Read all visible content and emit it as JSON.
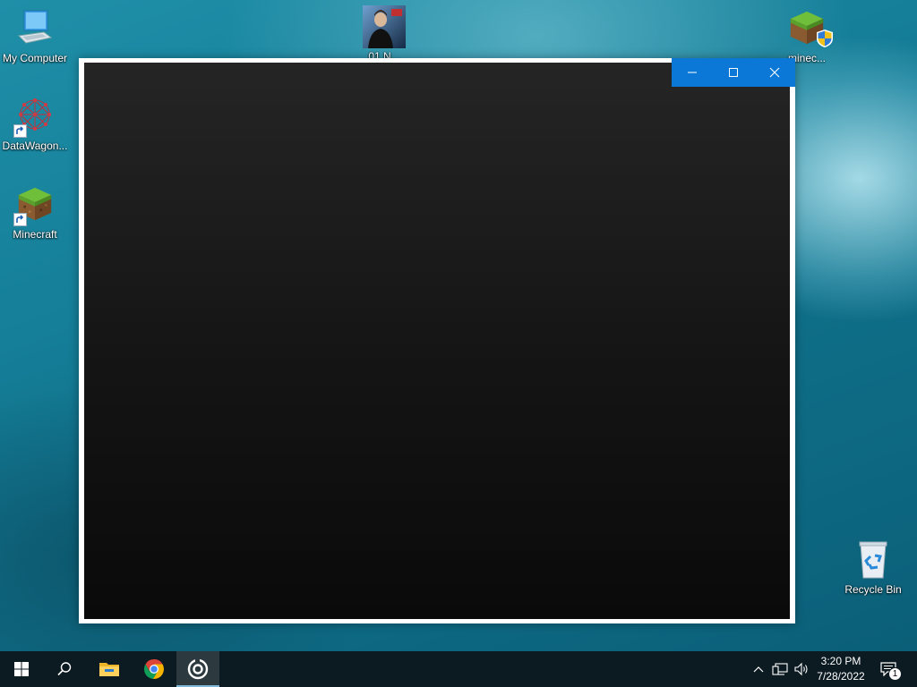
{
  "desktop": {
    "icons": [
      {
        "label": "My Computer",
        "icon": "computer-icon"
      },
      {
        "label": "DataWagon...",
        "icon": "network-graph-icon",
        "shortcut": true
      },
      {
        "label": "Minecraft",
        "icon": "grass-block-icon",
        "shortcut": true
      },
      {
        "label": "01 N...",
        "icon": "album-art-icon"
      },
      {
        "label": "minec...",
        "icon": "grass-block-shield-icon"
      },
      {
        "label": "Recycle Bin",
        "icon": "recycle-bin-icon"
      }
    ]
  },
  "window": {
    "controls": {
      "minimize": "minimize-icon",
      "maximize": "maximize-icon",
      "close": "close-icon"
    },
    "accent": "#0b78d7",
    "client_color": "#111111"
  },
  "taskbar": {
    "start": "windows-logo-icon",
    "search": "search-icon",
    "apps": [
      {
        "name": "file-explorer-icon"
      },
      {
        "name": "chrome-icon"
      },
      {
        "name": "target-app-icon",
        "active": true
      }
    ],
    "tray": {
      "chevron": "chevron-up-icon",
      "network": "network-icon",
      "volume": "volume-icon",
      "notifications": "notification-icon",
      "notification_count": "1"
    },
    "clock": {
      "time": "3:20 PM",
      "date": "7/28/2022"
    }
  }
}
